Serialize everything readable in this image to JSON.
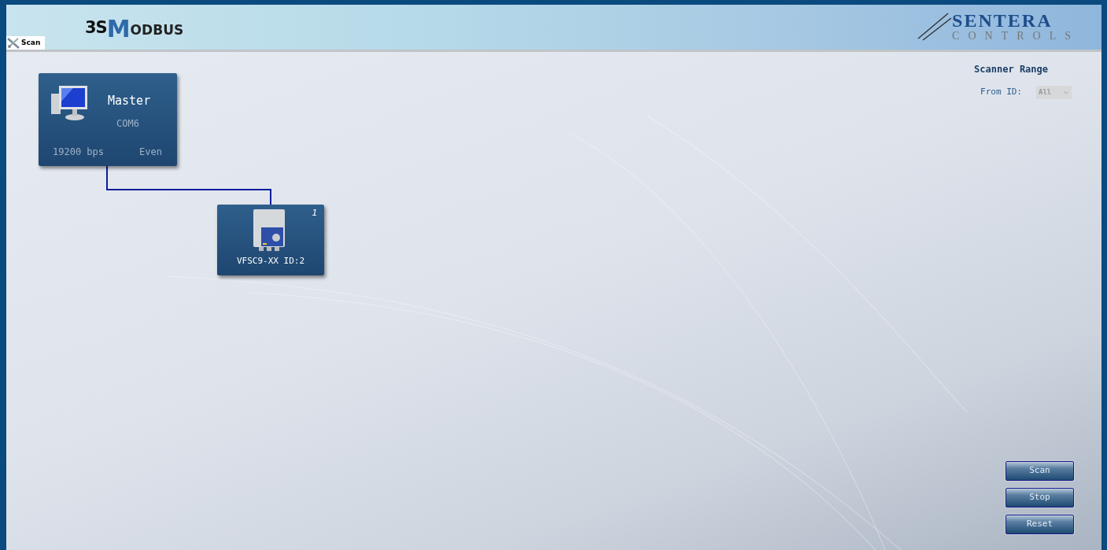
{
  "header": {
    "left_logo": {
      "prefix": "3S",
      "initial": "M",
      "rest": "ODBUS"
    },
    "right_logo": {
      "name": "SENTERA",
      "tagline": "CONTROLS"
    }
  },
  "tabs": [
    {
      "label": "Scan",
      "selected": true
    }
  ],
  "network": {
    "master": {
      "title": "Master",
      "port": "COM6",
      "baud": "19200 bps",
      "parity": "Even"
    },
    "devices": [
      {
        "index": "1",
        "label": "VFSC9-XX ID:2"
      }
    ]
  },
  "scanner_range": {
    "title": "Scanner Range",
    "from_label": "From ID:",
    "from_value": "All",
    "disabled": true
  },
  "buttons": [
    "Scan",
    "Stop",
    "Reset"
  ]
}
